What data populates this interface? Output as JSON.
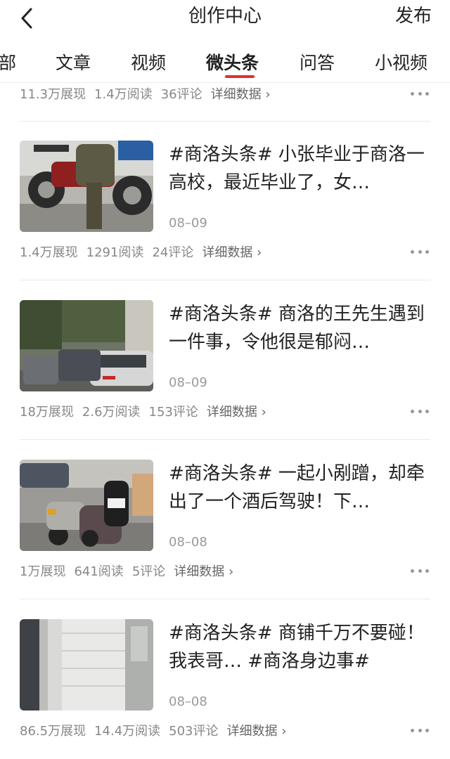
{
  "header": {
    "title": "创作中心",
    "publish": "发布"
  },
  "tabs": [
    "部",
    "文章",
    "视频",
    "微头条",
    "问答",
    "小视频"
  ],
  "active_tab_index": 3,
  "top_stats": {
    "views": "11.3万展现",
    "reads": "1.4万阅读",
    "comments": "36评论",
    "detail": "详细数据 ›"
  },
  "items": [
    {
      "title": "#商洛头条# 小张毕业于商洛一高校，最近毕业了，女…",
      "date": "08–09",
      "views": "1.4万展现",
      "reads": "1291阅读",
      "comments": "24评论",
      "detail": "详细数据 ›",
      "thumb_desc": "motorcycle"
    },
    {
      "title": "#商洛头条# 商洛的王先生遇到一件事，令他很是郁闷…",
      "date": "08–09",
      "views": "18万展现",
      "reads": "2.6万阅读",
      "comments": "153评论",
      "detail": "详细数据 ›",
      "thumb_desc": "parked-cars"
    },
    {
      "title": "#商洛头条# 一起小剐蹭，却牵出了一个酒后驾驶！下…",
      "date": "08–08",
      "views": "1万展现",
      "reads": "641阅读",
      "comments": "5评论",
      "detail": "详细数据 ›",
      "thumb_desc": "scooters"
    },
    {
      "title": "#商洛头条# 商铺千万不要碰！我表哥… #商洛身边事#",
      "date": "08–08",
      "views": "86.5万展现",
      "reads": "14.4万阅读",
      "comments": "503评论",
      "detail": "详细数据 ›",
      "thumb_desc": "shop-shutter"
    }
  ],
  "colors": {
    "accent": "#e0302f",
    "text": "#222222",
    "muted": "#888888"
  }
}
